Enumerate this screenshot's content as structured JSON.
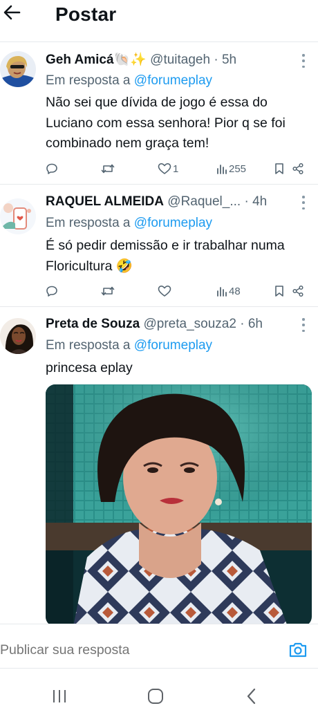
{
  "header": {
    "title": "Postar"
  },
  "tweets": [
    {
      "name": "Geh Amicá🐚✨",
      "handle": "@tuitageh",
      "time": "· 5h",
      "reply_prefix": "Em resposta a",
      "reply_to": "@forumeplay",
      "text": "Não sei que dívida de jogo é essa do Luciano com essa senhora! Pior q se foi combinado nem graça tem!",
      "likes": "1",
      "views": "255"
    },
    {
      "name": "RAQUEL ALMEIDA",
      "handle": "@Raquel_...",
      "time": "· 4h",
      "reply_prefix": "Em resposta a",
      "reply_to": "@forumeplay",
      "text": "É só pedir demissão e ir trabalhar numa Floricultura 🤣",
      "likes": "",
      "views": "48"
    },
    {
      "name": "Preta de Souza",
      "handle": "@preta_souza2",
      "time": "· 6h",
      "reply_prefix": "Em resposta a",
      "reply_to": "@forumeplay",
      "text": "princesa eplay"
    }
  ],
  "compose": {
    "placeholder": "Publicar sua resposta"
  },
  "icons": {
    "back": "arrow-left-icon",
    "reply": "comment-icon",
    "retweet": "retweet-icon",
    "like": "heart-icon",
    "views": "bar-chart-icon",
    "bookmark": "bookmark-icon",
    "share": "share-icon",
    "camera": "camera-icon"
  },
  "colors": {
    "accent": "#1d9bf0",
    "muted": "#536471",
    "text": "#0f1419"
  }
}
